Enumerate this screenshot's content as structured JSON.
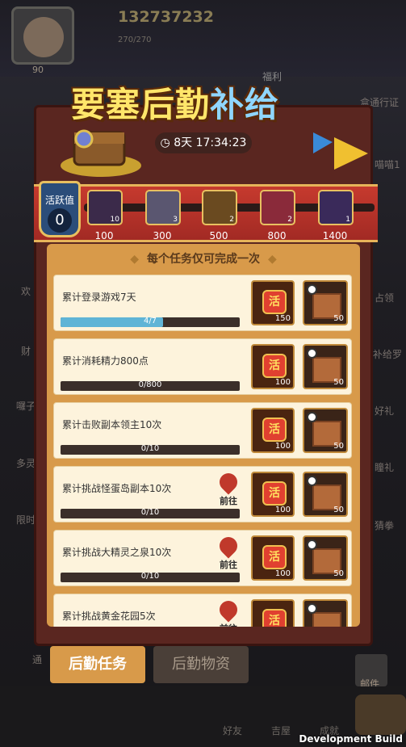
{
  "header": {
    "gold": "132737232",
    "energy": "270/270",
    "level": "90"
  },
  "side_labels": {
    "left": [
      "欢",
      "财",
      "囉子",
      "多灵",
      "限时",
      "通"
    ],
    "right": [
      "盒通行证",
      "喵喵1",
      "占领",
      "补给罗",
      "好礼",
      "瞳礼",
      "猜拳"
    ]
  },
  "event": {
    "title_part1": "要塞后勤",
    "title_part2": "补给",
    "timer": "8天 17:34:23",
    "banner_tag": "福利"
  },
  "activity": {
    "label": "活跃值",
    "value": "0",
    "badge": "活"
  },
  "milestones": [
    {
      "value": "100",
      "count": "10"
    },
    {
      "value": "300",
      "count": "3"
    },
    {
      "value": "500",
      "count": "2"
    },
    {
      "value": "800",
      "count": "2"
    },
    {
      "value": "1400",
      "count": "1"
    }
  ],
  "subtitle": "每个任务仅可完成一次",
  "tasks": [
    {
      "name": "累计登录游戏7天",
      "progress": "4/7",
      "fraction": 0.5714,
      "act_symbol": "活",
      "act_reward": "150",
      "box_reward": "50",
      "go": ""
    },
    {
      "name": "累计消耗精力800点",
      "progress": "0/800",
      "fraction": 0,
      "act_symbol": "活",
      "act_reward": "100",
      "box_reward": "50",
      "go": ""
    },
    {
      "name": "累计击败副本领主10次",
      "progress": "0/10",
      "fraction": 0,
      "act_symbol": "活",
      "act_reward": "100",
      "box_reward": "50",
      "go": ""
    },
    {
      "name": "累计挑战怪蛋岛副本10次",
      "progress": "0/10",
      "fraction": 0,
      "act_symbol": "活",
      "act_reward": "100",
      "box_reward": "50",
      "go": "前往"
    },
    {
      "name": "累计挑战大精灵之泉10次",
      "progress": "0/10",
      "fraction": 0,
      "act_symbol": "活",
      "act_reward": "100",
      "box_reward": "50",
      "go": "前往"
    },
    {
      "name": "累计挑战黄金花园5次",
      "progress": "",
      "fraction": 0,
      "act_symbol": "活",
      "act_reward": "",
      "box_reward": "",
      "go": "前往"
    }
  ],
  "tabs": {
    "active": "后勤任务",
    "inactive": "后勤物资"
  },
  "bottom": {
    "mail": "邮件",
    "friends": "好友",
    "house": "吉屋",
    "achievements": "成就",
    "dev_build": "Development Build"
  },
  "colors": {
    "accent": "#d89a4a",
    "progress_fill": "#5fb4d6",
    "ribbon": "#c63a2e"
  }
}
